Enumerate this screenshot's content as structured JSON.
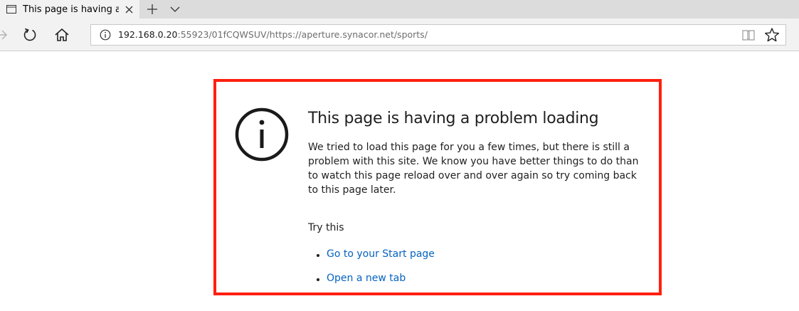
{
  "browser": {
    "tab": {
      "title": "This page is having a pr"
    },
    "address": {
      "host": "192.168.0.20",
      "rest": ":55923/01fCQWSUV/https://aperture.synacor.net/sports/"
    }
  },
  "error": {
    "title": "This page is having a problem loading",
    "body": "We tried to load this page for you a few times, but there is still a problem with this site. We know you have better things to do than to watch this page reload over and over again so try coming back to this page later.",
    "try_title": "Try this",
    "links": [
      {
        "label": "Go to your Start page"
      },
      {
        "label": "Open a new tab"
      }
    ]
  },
  "colors": {
    "highlight_border": "#ff1f0f",
    "link": "#0563c1"
  }
}
